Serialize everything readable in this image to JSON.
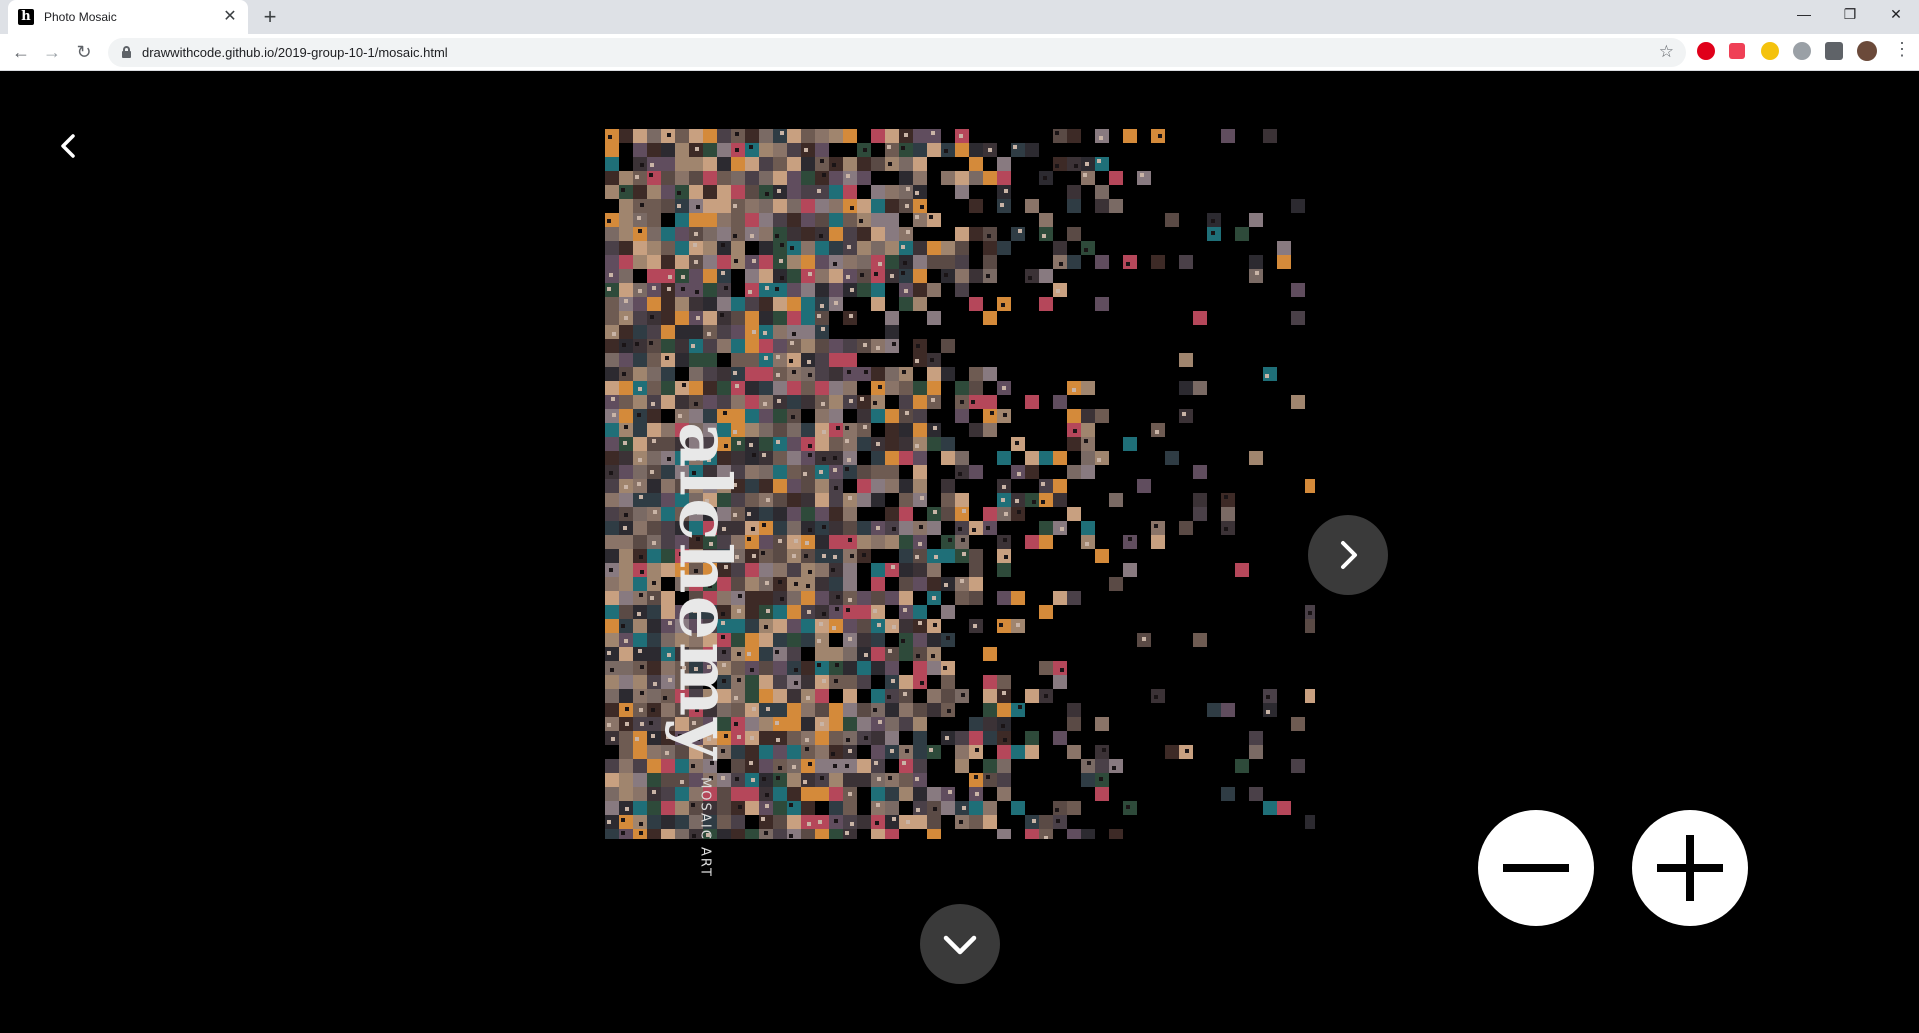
{
  "browser": {
    "tab_title": "Photo Mosaic",
    "favicon_text": "h",
    "url": "drawwithcode.github.io/2019-group-10-1/mosaic.html",
    "icons": [
      "back-icon",
      "forward-icon",
      "reload-icon",
      "lock-icon",
      "star-icon",
      "opera-icon",
      "pocket-icon",
      "extension-icon",
      "reddit-icon",
      "puzzle-icon",
      "profile-avatar",
      "more-icon"
    ]
  },
  "page": {
    "mosaic_word": "alchemy",
    "mosaic_small_text": "MOSAIC ART",
    "colors": {
      "background": "#000000",
      "control_dark": "#3a3a3a",
      "control_light": "#ffffff"
    }
  }
}
